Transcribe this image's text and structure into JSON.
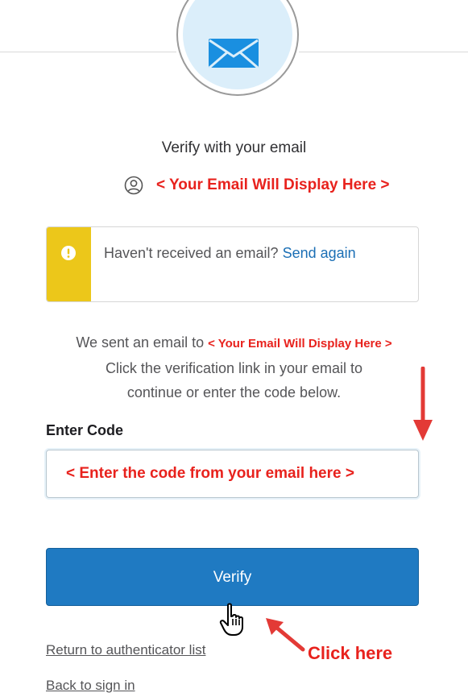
{
  "header": {
    "title": "Verify with your email",
    "icon": "envelope-icon"
  },
  "user": {
    "icon": "user-icon",
    "email_placeholder": "< Your Email Will Display Here >"
  },
  "callout": {
    "icon": "warning-icon",
    "text": "Haven't received an email? ",
    "link_text": "Send again",
    "accent_color": "#ecc71a"
  },
  "message": {
    "line1_prefix": "We sent an email to",
    "line1_email": "< Your Email Will Display Here >",
    "line2": "Click the verification link in your email to",
    "line3": "continue or enter the code below."
  },
  "code": {
    "label": "Enter Code",
    "placeholder": "< Enter the code from your email here >"
  },
  "verify_button": {
    "label": "Verify",
    "color": "#1f7ac2"
  },
  "links": {
    "return_label": "Return to authenticator list",
    "back_label": "Back to sign in"
  },
  "annotation": {
    "label": "Click here",
    "color": "#e8221d"
  }
}
